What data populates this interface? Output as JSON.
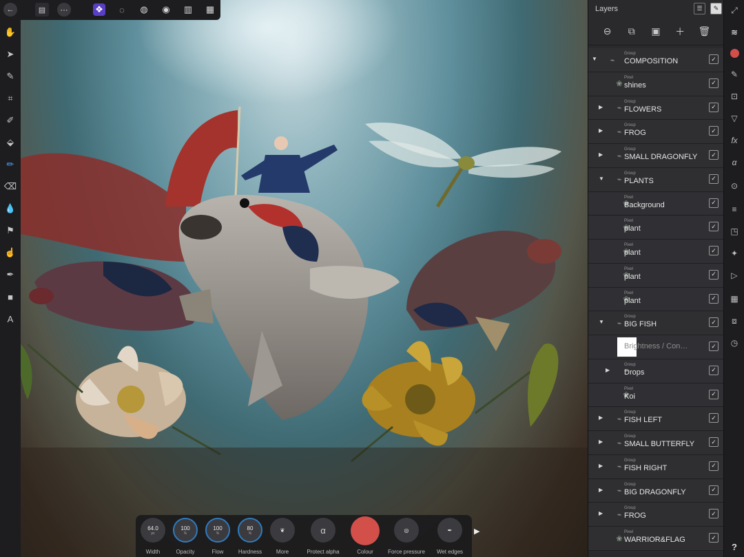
{
  "panel_title": "Layers",
  "layers": [
    {
      "type": "Group",
      "name": "COMPOSITION",
      "expanded": true,
      "level": 0
    },
    {
      "type": "Pixel",
      "name": "shines",
      "level": 1
    },
    {
      "type": "Group",
      "name": "FLOWERS",
      "expanded": false,
      "level": 1
    },
    {
      "type": "Group",
      "name": "FROG",
      "expanded": false,
      "level": 1
    },
    {
      "type": "Group",
      "name": "SMALL DRAGONFLY",
      "expanded": false,
      "level": 1
    },
    {
      "type": "Group",
      "name": "PLANTS",
      "expanded": true,
      "level": 1
    },
    {
      "type": "Pixel",
      "name": "Background",
      "level": 2
    },
    {
      "type": "Pixel",
      "name": "plant",
      "level": 2
    },
    {
      "type": "Pixel",
      "name": "plant",
      "level": 2
    },
    {
      "type": "Pixel",
      "name": "plant",
      "level": 2
    },
    {
      "type": "Pixel",
      "name": "plant",
      "level": 2
    },
    {
      "type": "Group",
      "name": "BIG FISH",
      "expanded": true,
      "level": 1
    },
    {
      "type": "",
      "name": "Brightness / Con…",
      "level": 2,
      "dim": true
    },
    {
      "type": "Group",
      "name": "Drops",
      "expanded": false,
      "level": 2
    },
    {
      "type": "Pixel",
      "name": "Koi",
      "level": 2,
      "selected": true
    },
    {
      "type": "Group",
      "name": "FISH LEFT",
      "expanded": false,
      "level": 1
    },
    {
      "type": "Group",
      "name": "SMALL BUTTERFLY",
      "expanded": false,
      "level": 1
    },
    {
      "type": "Group",
      "name": "FISH RIGHT",
      "expanded": false,
      "level": 1
    },
    {
      "type": "Group",
      "name": "BIG DRAGONFLY",
      "expanded": false,
      "level": 1
    },
    {
      "type": "Group",
      "name": "FROG",
      "expanded": false,
      "level": 1
    },
    {
      "type": "Pixel",
      "name": "WARRIOR&FLAG",
      "level": 1
    }
  ],
  "context_toolbar": {
    "width": {
      "value": "64.0",
      "unit": "px",
      "label": "Width"
    },
    "opacity": {
      "value": "100",
      "unit": "%",
      "label": "Opacity"
    },
    "flow": {
      "value": "100",
      "unit": "%",
      "label": "Flow"
    },
    "hardness": {
      "value": "80",
      "unit": "%",
      "label": "Hardness"
    },
    "more": {
      "label": "More"
    },
    "protect_alpha": {
      "label": "Protect alpha",
      "glyph": "α"
    },
    "colour": {
      "label": "Colour",
      "color": "#d24f4a"
    },
    "force_pressure": {
      "label": "Force pressure"
    },
    "wet_edges": {
      "label": "Wet edges"
    }
  },
  "studio_strip": {
    "help_label": "?"
  },
  "colors": {
    "accent": "#2f7bbf",
    "active_tool": "#4aa3ff",
    "brush_colour": "#d24f4a",
    "panel_bg": "#2a2a2d"
  }
}
